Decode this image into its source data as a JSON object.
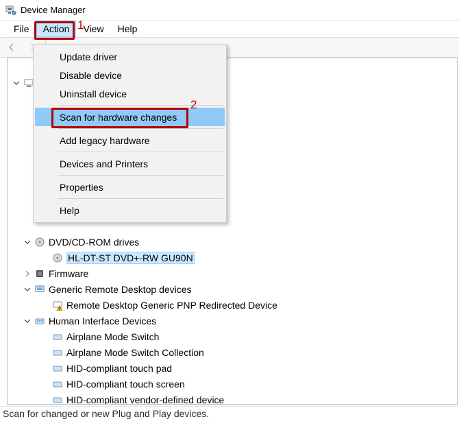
{
  "window": {
    "title": "Device Manager"
  },
  "menubar": {
    "file": "File",
    "action": "Action",
    "view": "View",
    "help": "Help"
  },
  "dropdown": {
    "update_driver": "Update driver",
    "disable_device": "Disable device",
    "uninstall_device": "Uninstall device",
    "scan_hw": "Scan for hardware changes",
    "add_legacy_hw": "Add legacy hardware",
    "devices_printers": "Devices and Printers",
    "properties": "Properties",
    "help": "Help"
  },
  "annotations": {
    "one": "1",
    "two": "2"
  },
  "tree": {
    "dvd": {
      "label": "DVD/CD-ROM drives",
      "child": "HL-DT-ST DVD+-RW GU90N"
    },
    "firmware": {
      "label": "Firmware"
    },
    "grd": {
      "label": "Generic Remote Desktop devices",
      "child": "Remote Desktop Generic PNP Redirected Device"
    },
    "hid": {
      "label": "Human Interface Devices",
      "c1": "Airplane Mode Switch",
      "c2": "Airplane Mode Switch Collection",
      "c3": "HID-compliant touch pad",
      "c4": "HID-compliant touch screen",
      "c5": "HID-compliant vendor-defined device"
    }
  },
  "statusbar": {
    "text": "Scan for changed or new Plug and Play devices."
  }
}
